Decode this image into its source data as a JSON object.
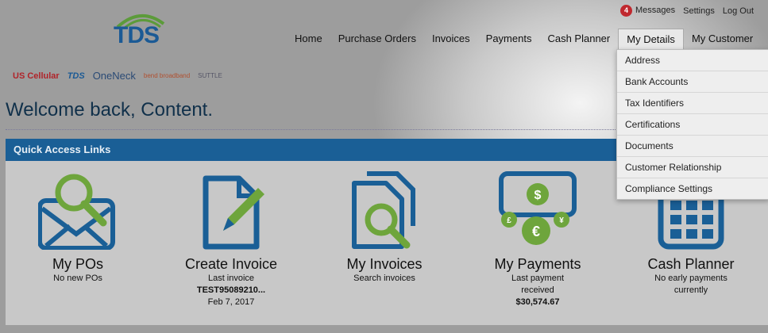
{
  "brand": {
    "logo_text": "TDS"
  },
  "topbar": {
    "messages_count": "4",
    "messages": "Messages",
    "settings": "Settings",
    "logout": "Log Out"
  },
  "nav": {
    "items": [
      "Home",
      "Purchase Orders",
      "Invoices",
      "Payments",
      "Cash Planner",
      "My Details",
      "My Customer"
    ]
  },
  "partners": [
    "US Cellular",
    "TDS",
    "OneNeck",
    "bend broadband",
    "SUTTLE"
  ],
  "welcome": "Welcome back, Content.",
  "quick": {
    "title": "Quick Access Links"
  },
  "tiles": [
    {
      "title": "My POs",
      "lines": [
        "No new POs"
      ]
    },
    {
      "title": "Create Invoice",
      "lines": [
        "Last invoice",
        "TEST95089210...",
        "Feb 7, 2017"
      ]
    },
    {
      "title": "My Invoices",
      "lines": [
        "Search invoices"
      ]
    },
    {
      "title": "My Payments",
      "lines": [
        "Last payment",
        "received",
        "$30,574.67"
      ]
    },
    {
      "title": "Cash Planner",
      "lines": [
        "No early payments",
        "currently"
      ]
    }
  ],
  "dropdown": {
    "items": [
      "Address",
      "Bank Accounts",
      "Tax Identifiers",
      "Certifications",
      "Documents",
      "Customer Relationship",
      "Compliance Settings"
    ]
  },
  "colors": {
    "blue": "#1a5f96",
    "green": "#6ea53c"
  }
}
